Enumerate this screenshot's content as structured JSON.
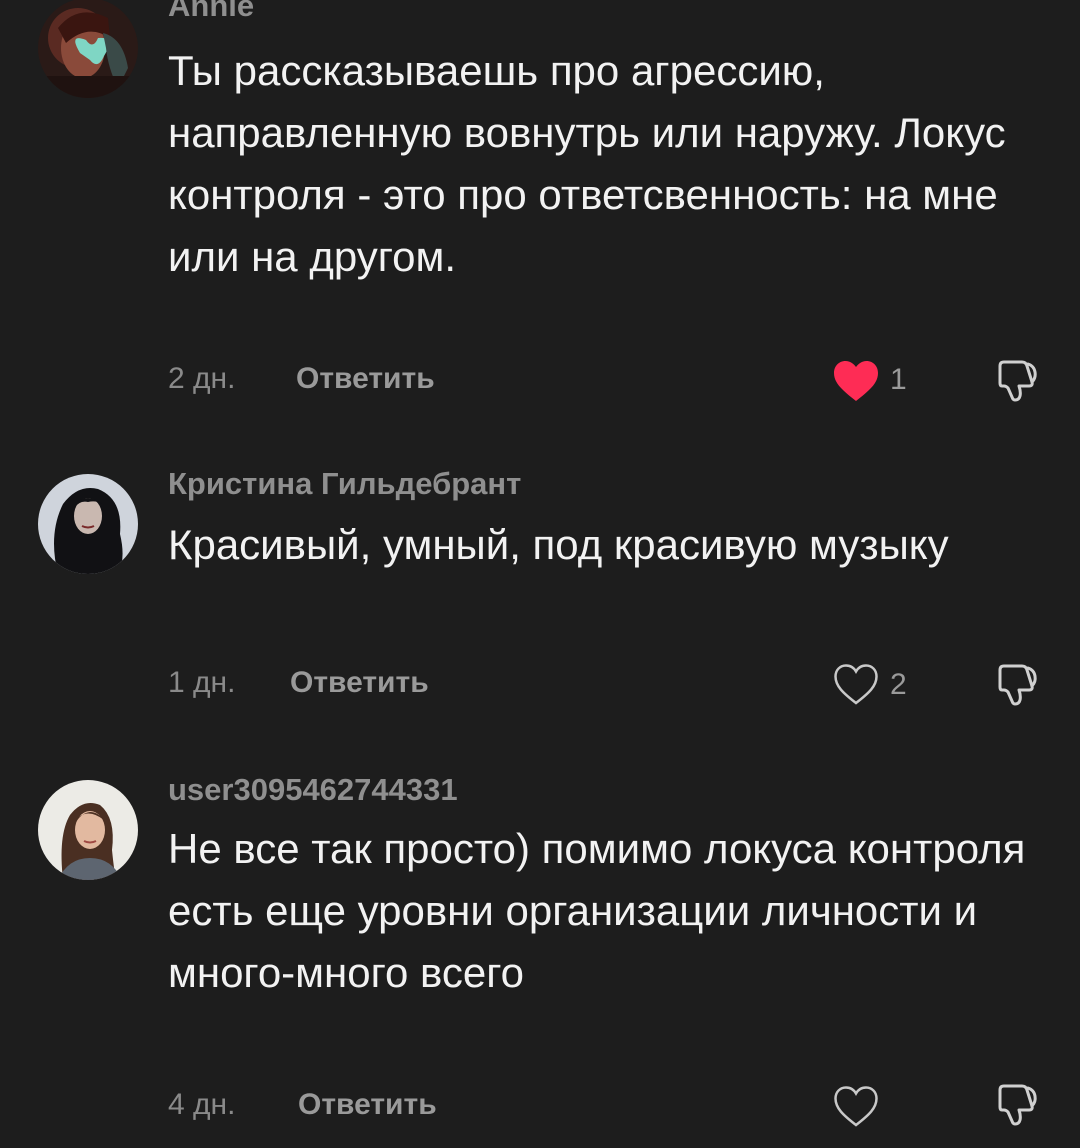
{
  "comments": [
    {
      "username": "Annie",
      "text": "Ты рассказываешь про агрессию, направленную вовнутрь или наружу. Локус контроля - это про ответсвенность: на мне или на другом.",
      "time": "2 дн.",
      "reply_label": "Ответить",
      "liked": true,
      "like_count": "1",
      "avatar_icon": "avatar-woman-butterfly"
    },
    {
      "username": "Кристина Гильдебрант",
      "text": "Красивый, умный, под красивую музыку",
      "time": "1 дн.",
      "reply_label": "Ответить",
      "liked": false,
      "like_count": "2",
      "avatar_icon": "avatar-woman-dark-hair"
    },
    {
      "username": "user3095462744331",
      "text": "Не все так просто) помимо локуса контроля есть еще уровни организации личности и много-много всего",
      "time": "4 дн.",
      "reply_label": "Ответить",
      "liked": false,
      "like_count": "",
      "avatar_icon": "avatar-woman-portrait"
    }
  ],
  "colors": {
    "background": "#1d1d1d",
    "like_active": "#fe2c55",
    "muted_text": "#8a8a8a"
  },
  "icons": {
    "like": "heart-icon",
    "dislike": "thumbs-down-icon"
  }
}
